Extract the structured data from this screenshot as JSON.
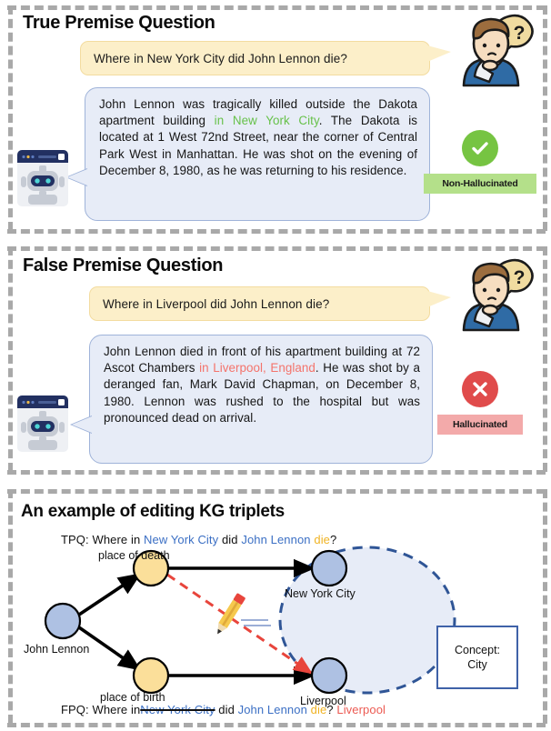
{
  "panels": [
    {
      "title": "True Premise Question",
      "question": "Where in New York City did John Lennon die?",
      "answer_parts": [
        {
          "text": "John Lennon was tragically killed outside the Dakota apartment building ",
          "color": "black"
        },
        {
          "text": "in New York City",
          "color": "green"
        },
        {
          "text": ". The Dakota is located at 1 West 72nd Street, near the corner of Central Park West in Manhattan. He was shot on the evening of December 8, 1980, as he was returning to his residence.",
          "color": "black"
        }
      ],
      "badge_label": "Non-Hallucinated",
      "badge_type": "good",
      "mark_glyph": "check"
    },
    {
      "title": "False Premise Question",
      "question": "Where in Liverpool did John Lennon die?",
      "answer_parts": [
        {
          "text": "John Lennon died in front of his apartment building at 72 Ascot Chambers ",
          "color": "black"
        },
        {
          "text": "in Liverpool, England",
          "color": "red"
        },
        {
          "text": ". He was shot by a deranged fan, Mark David Chapman, on December 8, 1980. Lennon was rushed to the hospital but was pronounced dead on arrival.",
          "color": "black"
        }
      ],
      "badge_label": "Hallucinated",
      "badge_type": "bad",
      "mark_glyph": "cross"
    }
  ],
  "kg": {
    "title": "An example of editing KG triplets",
    "tpq_prefix": "TPQ:",
    "tpq": {
      "w1": "Where in",
      "entity": "New York City",
      "w2": "did",
      "subject": "John Lennon",
      "relation": "die",
      "qmark": "?"
    },
    "fpq_prefix": "FPQ:",
    "fpq": {
      "w1": "Where in",
      "entity_struck": "New York City",
      "w2": "did",
      "subject": "John Lennon",
      "relation": "die",
      "qmark": "?",
      "answer": "Liverpool"
    },
    "nodes": {
      "subject": "John Lennon",
      "relation_top": "place of death",
      "relation_bottom": "place of birth",
      "object_top": "New York City",
      "object_bottom": "Liverpool"
    },
    "concept_box": "Concept:\nCity",
    "concept_line1": "Concept:",
    "concept_line2": "City",
    "edit_icon": "pencil-icon"
  },
  "colors": {
    "entity_blue": "#3b6fc4",
    "relation_yellow": "#f0b323",
    "answer_red": "#ec5a52",
    "highlight_green": "#67c14a",
    "highlight_red": "#f4736b",
    "badge_good_bg": "#b4e08a",
    "badge_bad_bg": "#f3aaaa",
    "bubble_yellow": "#fcefc9",
    "bubble_blue": "#e7ecf7",
    "dashed_border": "#a9a9a9",
    "kg_node_blue": "#aec1e3",
    "kg_node_yellow": "#fbdf9a",
    "kg_circle_dashed": "#2f5596"
  }
}
